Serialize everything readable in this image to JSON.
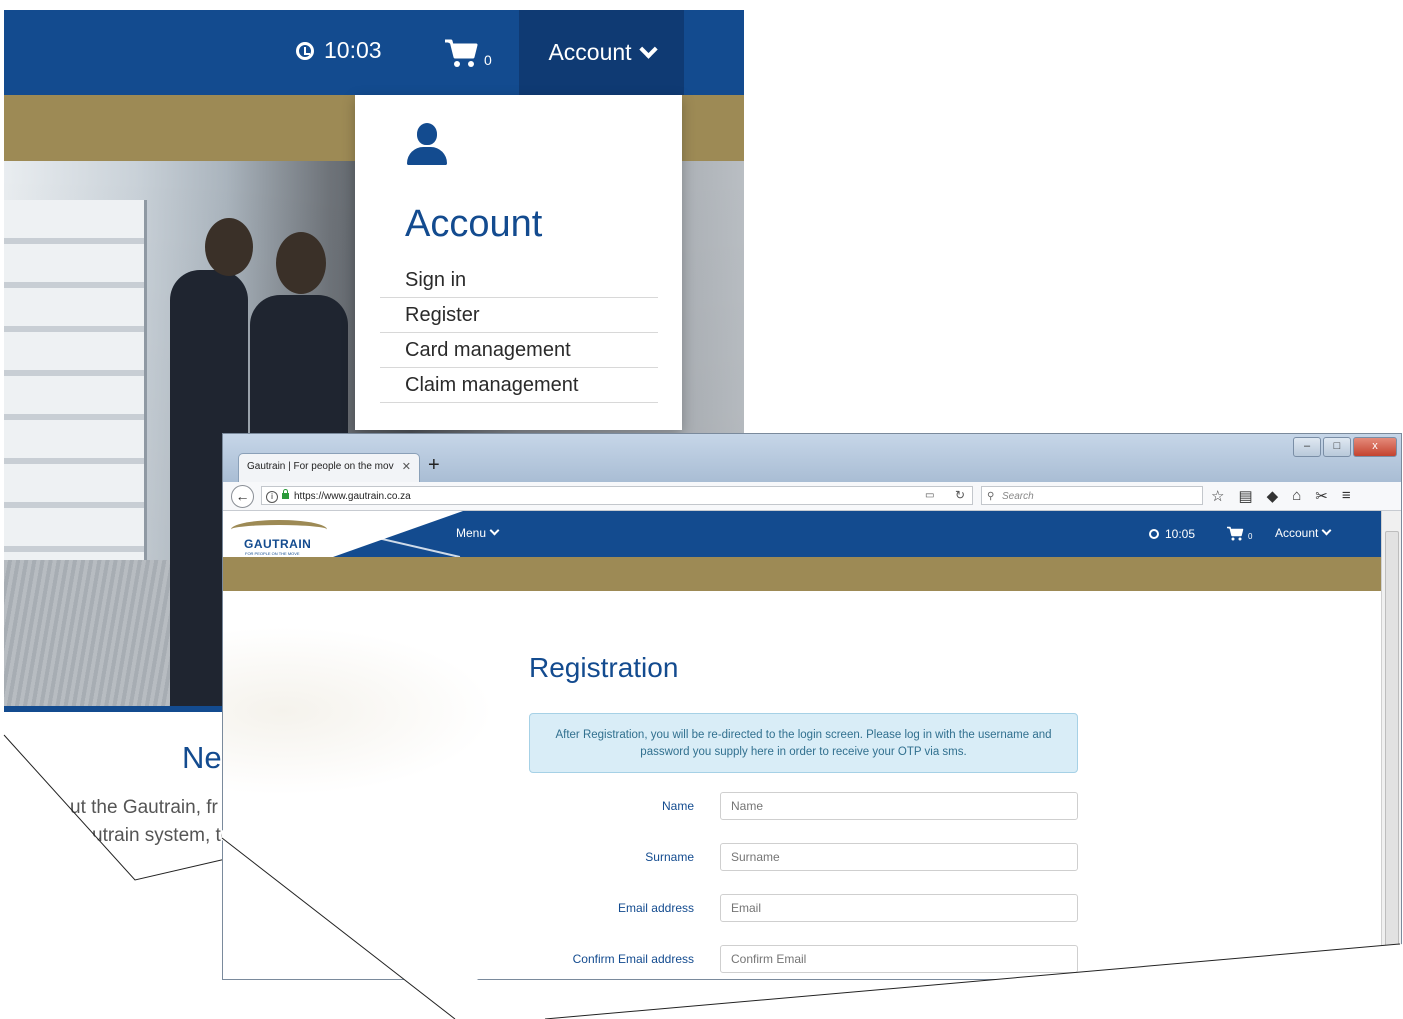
{
  "back": {
    "nav": {
      "time": "10:03",
      "cart_count": "0",
      "account_label": "Account"
    },
    "dropdown": {
      "title": "Account",
      "items": [
        "Sign in",
        "Register",
        "Card management",
        "Claim management"
      ]
    },
    "caption": {
      "title": "Ne",
      "line1": "ut the Gautrain, fr",
      "line2": "utrain system, to"
    }
  },
  "browser": {
    "tab_title": "Gautrain | For people on the mov",
    "url": "https://www.gautrain.co.za",
    "search_placeholder": "Search",
    "window_buttons": {
      "minimize": "–",
      "maximize": "□",
      "close": "x"
    }
  },
  "site": {
    "logo_text": "GAUTRAIN",
    "logo_sub": "FOR PEOPLE ON THE MOVE",
    "menu_label": "Menu",
    "time": "10:05",
    "cart_count": "0",
    "account_label": "Account"
  },
  "registration": {
    "title": "Registration",
    "notice": "After Registration, you will be re-directed to the login screen. Please log in with the username and password you supply here in order to receive your OTP via sms.",
    "fields": [
      {
        "label": "Name",
        "placeholder": "Name"
      },
      {
        "label": "Surname",
        "placeholder": "Surname"
      },
      {
        "label": "Email address",
        "placeholder": "Email"
      },
      {
        "label": "Confirm Email address",
        "placeholder": "Confirm Email"
      }
    ]
  },
  "colors": {
    "brand_blue": "#134b8f",
    "gold": "#9d8a55",
    "alert_bg": "#d9edf7",
    "alert_text": "#31708f"
  }
}
